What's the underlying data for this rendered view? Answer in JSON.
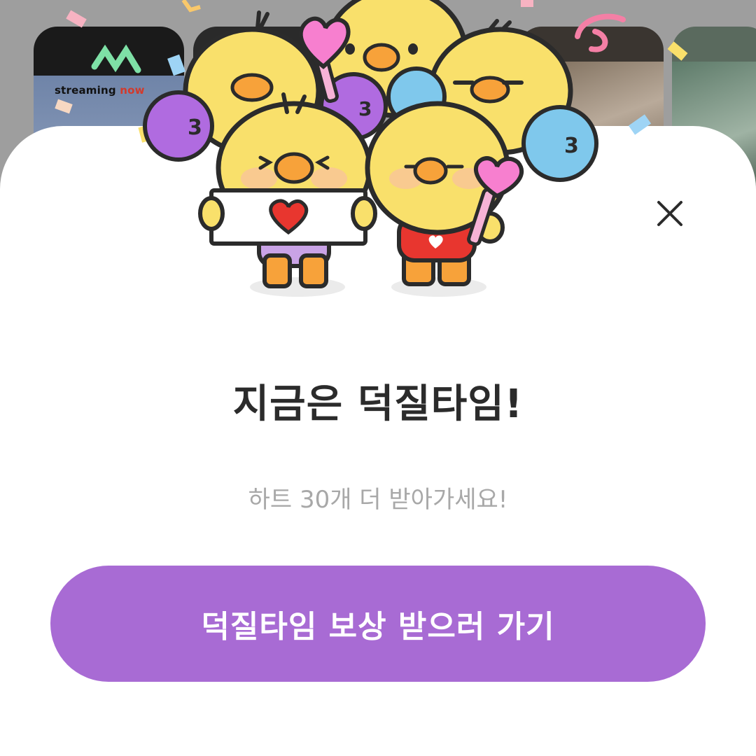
{
  "background": {
    "stream_label_prefix": "streaming",
    "stream_label_suffix": "now"
  },
  "dialog": {
    "title": "지금은 덕질타임!",
    "subtitle": "하트 30개 더 받아가세요!",
    "cta_label": "덕질타임 보상 받으러 가기",
    "close_icon": "close-icon"
  },
  "colors": {
    "cta_background": "#a86bd4",
    "title_text": "#2b2b2b",
    "subtitle_text": "#a8a8a8",
    "chick_yellow": "#f9e06b",
    "chick_beak": "#f7a23a"
  }
}
